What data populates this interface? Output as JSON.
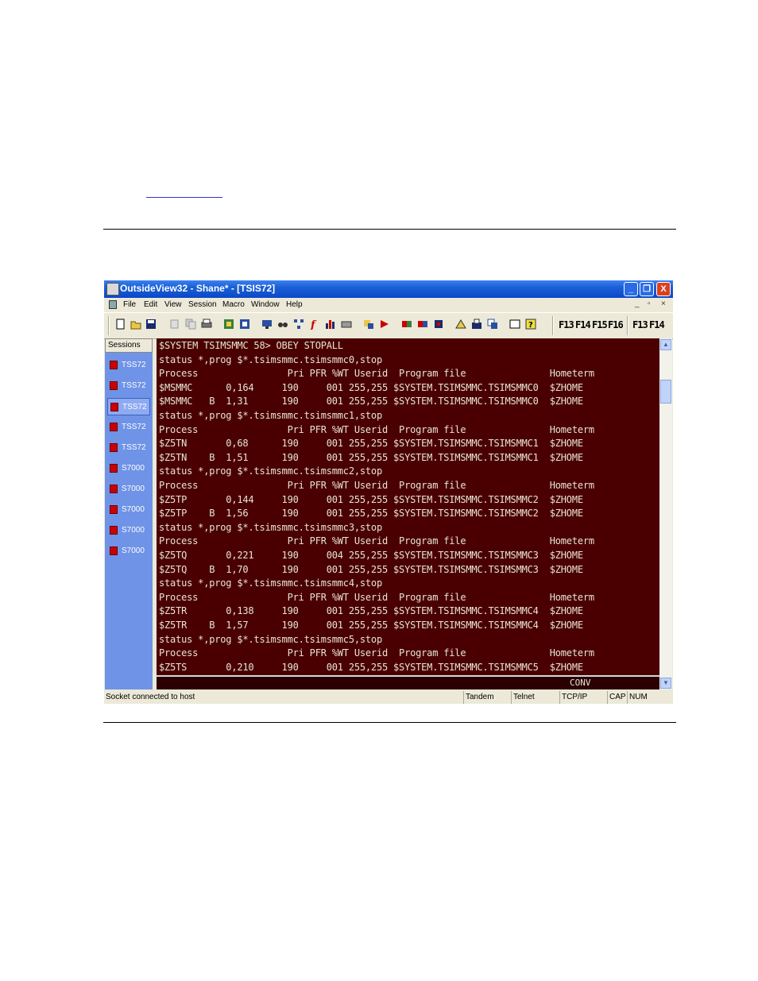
{
  "window": {
    "title": "OutsideView32 - Shane* - [TSIS72]",
    "buttons": {
      "minimize": "_",
      "restore": "❐",
      "close": "X"
    },
    "mdi_buttons": {
      "minimize": "_",
      "restore": "▫",
      "close": "×"
    }
  },
  "menu": [
    "File",
    "Edit",
    "View",
    "Session",
    "Macro",
    "Window",
    "Help"
  ],
  "toolbar": {
    "fkeys": [
      "F13",
      "F14",
      "F15",
      "F16",
      "F13",
      "F14"
    ]
  },
  "sessions": {
    "header": "Sessions",
    "items": [
      {
        "label": "TSS72",
        "active": false
      },
      {
        "label": "TSS72",
        "active": false
      },
      {
        "label": "TSS72",
        "active": true
      },
      {
        "label": "TSS72",
        "active": false
      },
      {
        "label": "TSS72",
        "active": false
      },
      {
        "label": "S7000",
        "active": false
      },
      {
        "label": "S7000",
        "active": false
      },
      {
        "label": "S7000",
        "active": false
      },
      {
        "label": "S7000",
        "active": false
      },
      {
        "label": "S7000",
        "active": false
      }
    ]
  },
  "terminal": {
    "lines": [
      "$SYSTEM TSIMSMMC 58> OBEY STOPALL",
      "status *,prog $*.tsimsmmc.tsimsmmc0,stop",
      "Process                Pri PFR %WT Userid  Program file               Hometerm",
      "$MSMMC      0,164     190     001 255,255 $SYSTEM.TSIMSMMC.TSIMSMMC0  $ZHOME",
      "$MSMMC   B  1,31      190     001 255,255 $SYSTEM.TSIMSMMC.TSIMSMMC0  $ZHOME",
      "status *,prog $*.tsimsmmc.tsimsmmc1,stop",
      "Process                Pri PFR %WT Userid  Program file               Hometerm",
      "$Z5TN       0,68      190     001 255,255 $SYSTEM.TSIMSMMC.TSIMSMMC1  $ZHOME",
      "$Z5TN    B  1,51      190     001 255,255 $SYSTEM.TSIMSMMC.TSIMSMMC1  $ZHOME",
      "status *,prog $*.tsimsmmc.tsimsmmc2,stop",
      "Process                Pri PFR %WT Userid  Program file               Hometerm",
      "$Z5TP       0,144     190     001 255,255 $SYSTEM.TSIMSMMC.TSIMSMMC2  $ZHOME",
      "$Z5TP    B  1,56      190     001 255,255 $SYSTEM.TSIMSMMC.TSIMSMMC2  $ZHOME",
      "status *,prog $*.tsimsmmc.tsimsmmc3,stop",
      "Process                Pri PFR %WT Userid  Program file               Hometerm",
      "$Z5TQ       0,221     190     004 255,255 $SYSTEM.TSIMSMMC.TSIMSMMC3  $ZHOME",
      "$Z5TQ    B  1,70      190     001 255,255 $SYSTEM.TSIMSMMC.TSIMSMMC3  $ZHOME",
      "status *,prog $*.tsimsmmc.tsimsmmc4,stop",
      "Process                Pri PFR %WT Userid  Program file               Hometerm",
      "$Z5TR       0,138     190     001 255,255 $SYSTEM.TSIMSMMC.TSIMSMMC4  $ZHOME",
      "$Z5TR    B  1,57      190     001 255,255 $SYSTEM.TSIMSMMC.TSIMSMMC4  $ZHOME",
      "status *,prog $*.tsimsmmc.tsimsmmc5,stop",
      "Process                Pri PFR %WT Userid  Program file               Hometerm",
      "$Z5TS       0,210     190     001 255,255 $SYSTEM.TSIMSMMC.TSIMSMMC5  $ZHOME"
    ],
    "mode": "CONV",
    "colors": {
      "background": "#4a0000",
      "text": "#e8e4d4"
    }
  },
  "statusbar": {
    "message": "Socket connected to host",
    "host_type": "Tandem",
    "protocol": "Telnet",
    "transport": "TCP/IP",
    "cap": "CAP",
    "num": "NUM"
  }
}
